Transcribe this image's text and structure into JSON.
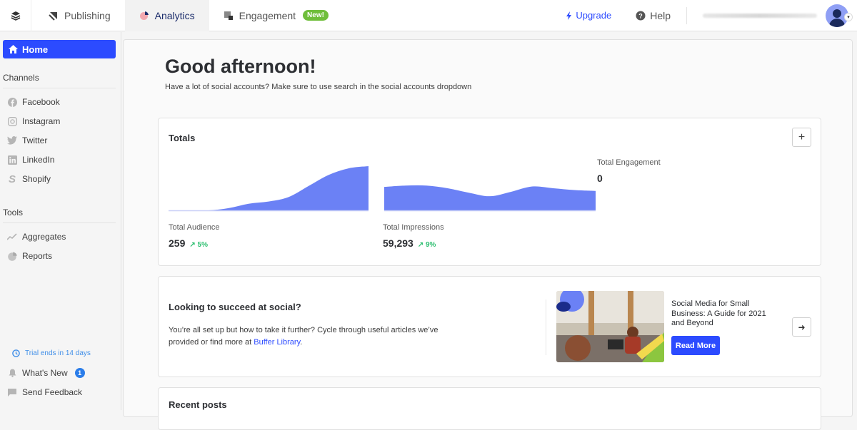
{
  "topbar": {
    "tabs": [
      {
        "label": "Publishing",
        "icon": "publishing-icon"
      },
      {
        "label": "Analytics",
        "icon": "analytics-pie-icon",
        "active": true
      },
      {
        "label": "Engagement",
        "icon": "engagement-icon",
        "badge": "New!"
      }
    ],
    "upgrade_label": "Upgrade",
    "help_label": "Help"
  },
  "sidebar": {
    "home_label": "Home",
    "channels_title": "Channels",
    "channels": [
      {
        "label": "Facebook",
        "icon": "facebook-icon"
      },
      {
        "label": "Instagram",
        "icon": "instagram-icon"
      },
      {
        "label": "Twitter",
        "icon": "twitter-icon"
      },
      {
        "label": "LinkedIn",
        "icon": "linkedin-icon"
      },
      {
        "label": "Shopify",
        "icon": "shopify-icon"
      }
    ],
    "tools_title": "Tools",
    "tools": [
      {
        "label": "Aggregates",
        "icon": "trend-line-icon"
      },
      {
        "label": "Reports",
        "icon": "pie-chart-icon"
      }
    ],
    "trial_text": "Trial ends in 14 days",
    "whats_new_label": "What's New",
    "whats_new_count": "1",
    "feedback_label": "Send Feedback"
  },
  "main": {
    "greeting": "Good afternoon!",
    "subtitle": "Have a lot of social accounts? Make sure to use search in the social accounts dropdown",
    "totals": {
      "title": "Totals",
      "add_label": "+",
      "metrics": [
        {
          "label": "Total Audience",
          "value": "259",
          "change": "5%"
        },
        {
          "label": "Total Impressions",
          "value": "59,293",
          "change": "9%"
        },
        {
          "label": "Total Engagement",
          "value": "0"
        }
      ]
    },
    "promo": {
      "title": "Looking to succeed at social?",
      "text": "You’re all set up but how to take it further? Cycle through useful articles we’ve provided or find more at ",
      "link_text": "Buffer Library",
      "text_end": ".",
      "article_title": "Social Media for Small Business: A Guide for 2021 and Beyond",
      "read_more_label": "Read More"
    },
    "recent_posts_title": "Recent posts"
  },
  "colors": {
    "accent": "#2c4bff",
    "chart_fill": "#6b81f5",
    "positive": "#2fbf71",
    "new_badge": "#6fbe3b"
  },
  "chart_data": [
    {
      "type": "area",
      "title": "Total Audience",
      "x": [
        0,
        1,
        2,
        3,
        4,
        5,
        6,
        7,
        8,
        9,
        10
      ],
      "values": [
        0,
        0,
        0,
        0.5,
        1.5,
        2,
        3,
        5.5,
        8,
        9.5,
        10
      ],
      "ylim": [
        0,
        10
      ]
    },
    {
      "type": "area",
      "title": "Total Impressions",
      "x": [
        0,
        1,
        2,
        3,
        4,
        5,
        6,
        7,
        8,
        9,
        10
      ],
      "values": [
        5.3,
        5.6,
        5.6,
        5.0,
        4.0,
        3.2,
        4.2,
        5.4,
        5.0,
        4.6,
        4.4
      ],
      "ylim": [
        0,
        10
      ]
    }
  ]
}
